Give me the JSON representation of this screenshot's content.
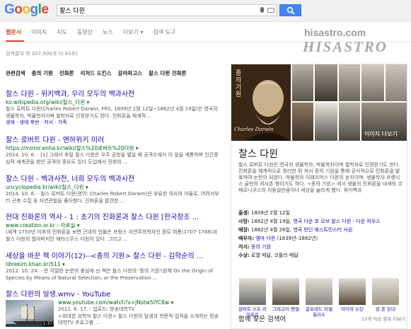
{
  "logo": {
    "text": "Google"
  },
  "search": {
    "query": "찰스 다윈"
  },
  "tabs": [
    {
      "label": "웹문서",
      "active": true
    },
    {
      "label": "이미지"
    },
    {
      "label": "지도"
    },
    {
      "label": "동영상"
    },
    {
      "label": "뉴스"
    },
    {
      "label": "더보기 ▾"
    },
    {
      "label": "검색 도구"
    }
  ],
  "stats": "검색결과 약 307,000개 (0.40초)",
  "watermark": {
    "small": "hisastro.com",
    "big": "HISASTRO"
  },
  "related": [
    "관련검색",
    "종의 기원",
    "진화론",
    "리처드 도킨스",
    "갈라파고스",
    "찰스 다윈 진화론"
  ],
  "results": [
    {
      "title": "찰스 다윈 - 위키백과, 우리 모두의 백과사전",
      "url": "ko.wikipedia.org/wiki/찰스_다윈 ▾",
      "snippet": "찰스 로버트 다윈(Charles Robert Darwin, FRS, 1809년 2월 12일~1882년 4월 19일)은 영국의 생물학자, 박물학자이며 철학자로 인정받기도 한다. 진화론을 체계적...",
      "links": "생애 · 생애 후반 · 저서 · 가족"
    },
    {
      "title": "찰스 로버트 다윈 - 엔하위키 미러",
      "url": "https://mirror.enha.kr/wiki/찰스%20로버트%20다윈 ▾",
      "snippet": "2014. 10. 6. - [1] 그래서 후일 찰스 다윈은 우주 공방을 벌일 때 공격수에서 이 앞을 계통하며 인간중심적 세계관을 받은 공격의 중요도 있다 도입에서 진화의 ..."
    },
    {
      "title": "찰스 다윈 - 백과사전, 너희 모두의 백과사전",
      "url": "uncyclopedia.kr/wiki/찰스_다윈 ▾",
      "snippet": "2014. 10. 6. - 찰스 로버트 다윈(영어: Charles Robert Darwin)은 부유한 의사의 아들로, 어려서부터 곤충 수집 등 자연관찰을 좋아했다. 진화론을 발견한 ..."
    },
    {
      "title": "현대 진화론의 역사 - 1 : 초기의 진화론과 찰스 다윈 [한국창조 ...",
      "url": "www.creation.or.kr › 자료실 ▾",
      "snippet": "(세계 1750년 이후의 진화론을 보면 근대의 인물은 프랑스 자연주의학자인 콩트 뷔퐁(1707-1788)과 찰스 다윈의 할아버지인 에라스무스 다윈이 있다. 그리고 ..."
    },
    {
      "title": "세상을 바꾼 책 이야기(12)--<종의 기원> 찰스 다윈 - 김학순의 ...",
      "url": "librekim.khan.kr/511 ▾",
      "snippet": "2012. 10. 24. - 한 치밀한 논문의 중심에 선 책은 찰스 다윈의 '종의 기원'(원제 On the Origin of Species by Means of Natural Selection, or the Preservation ..."
    },
    {
      "title": "찰스 다윈의 일생.wmv - YouTube",
      "url": "www.youtube.com/watch?v=JNstw5lYC6w ▾",
      "meta": "2011. 6. 17. - 업로드: 방송대학TV",
      "snippet": "<위대한 과학자 찰스 다윈> 찰스 다윈의 일생과 학문적 업적을 소개하는 방송대학TV 프로그램 ...",
      "duration": "1:37"
    }
  ],
  "knowledge_panel": {
    "title": "찰스 다윈",
    "more_images": "이미지 더보기",
    "book_text": "종의 기원",
    "signature": "Charles Darwin",
    "description": "찰스 로버트 다윈은 영국의 생물학자, 박물학자이며 철학자로 인정받기도 한다. 진화론을 체계적으로 정리한 뒤 저서 종의 기원을 통해 공식적으로 진화론을 발표하여 논란이 되었다. 박물학자 이래즈머스 다윈의 손자이며, 생물학자 프랜시스 골턴의 외사촌 형이기도 하다. <종의 기원> 에서 생물의 진화론을 내세워 코페르니쿠스의 지동설만큼이나 세상을 놀라게 했다. 위키백과",
    "facts": [
      {
        "label": "출생:",
        "value": "1809년 2월 12일"
      },
      {
        "label": "사망:",
        "value": "1882년 4월 19일, ",
        "link": "영국 다운 호 오브 찰스 다윈 - 다운 하우스"
      },
      {
        "label": "매장:",
        "value": "1882년 4월 26일, ",
        "link": "영국 런던 웨스트민스터 사원"
      },
      {
        "label": "배우자:",
        "value": "",
        "link": "엠마 다윈",
        "extra": " (1839년–1882년)"
      },
      {
        "label": "저서:",
        "value": "",
        "link": "종의 기원"
      },
      {
        "label": "수상:",
        "value": "로열 메달, 코플리 메달"
      }
    ],
    "people_title": "함께 찾은 검색어",
    "people_more": "15개 이상 항목 더보기",
    "people": [
      "알버트 스트 라이프로",
      "그레고어 멘델",
      "알프레드 러셀 윌리스",
      "아이작 뉴턴",
      "칼 폰 린네"
    ]
  },
  "colors": {
    "accent": "#dd4b39",
    "link": "#1a0dab",
    "url": "#006621",
    "button": "#4285f4"
  }
}
